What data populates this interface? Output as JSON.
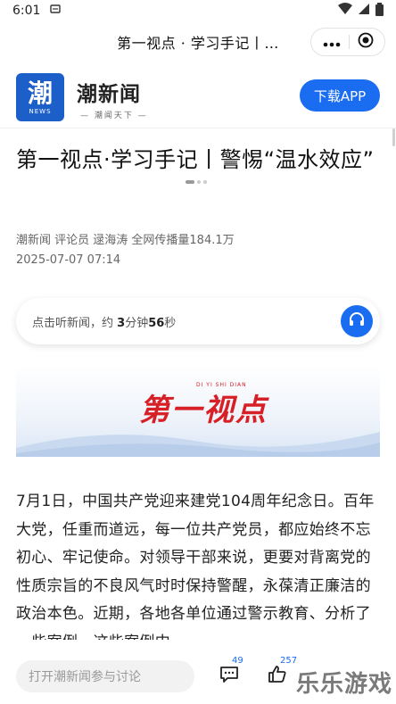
{
  "status_bar": {
    "time": "6:01"
  },
  "nav": {
    "title": "第一视点 · 学习手记丨…"
  },
  "banner": {
    "logo_char": "潮",
    "logo_sub": "NEWS",
    "brand_name": "潮新闻",
    "slogan": "— 潮闻天下 —",
    "download_label": "下载APP"
  },
  "article": {
    "headline": "第一视点·学习手记丨警惕“温水效应”",
    "meta": "潮新闻 评论员 逯海涛 全网传播量184.1万",
    "date": "2025-07-07 07:14",
    "audio": {
      "prefix": "点击听新闻，约 ",
      "minutes": "3",
      "mid": "分钟",
      "seconds": "56",
      "suffix": "秒"
    },
    "feature_logo": "第一视点",
    "feature_logo_sub": "DI YI SHI DIAN",
    "body": "7月1日，中国共产党迎来建党104周年纪念日。百年大党，任重而道远，每一位共产党员，都应始终不忘初心、牢记使命。对领导干部来说，更要对背离党的性质宗旨的不良风气时时保持警醒，永葆清正廉洁的政治本色。近期，各地各单位通过警示教育、分析了一些案例，这些案例中"
  },
  "bottom": {
    "comment_placeholder": "打开潮新闻参与讨论",
    "comment_count": "49",
    "like_count": "257"
  },
  "watermark": "乐乐游戏",
  "colors": {
    "accent": "#1a6cf0",
    "logo_bg": "#1d5fc9",
    "feature_red": "#d71f26"
  }
}
